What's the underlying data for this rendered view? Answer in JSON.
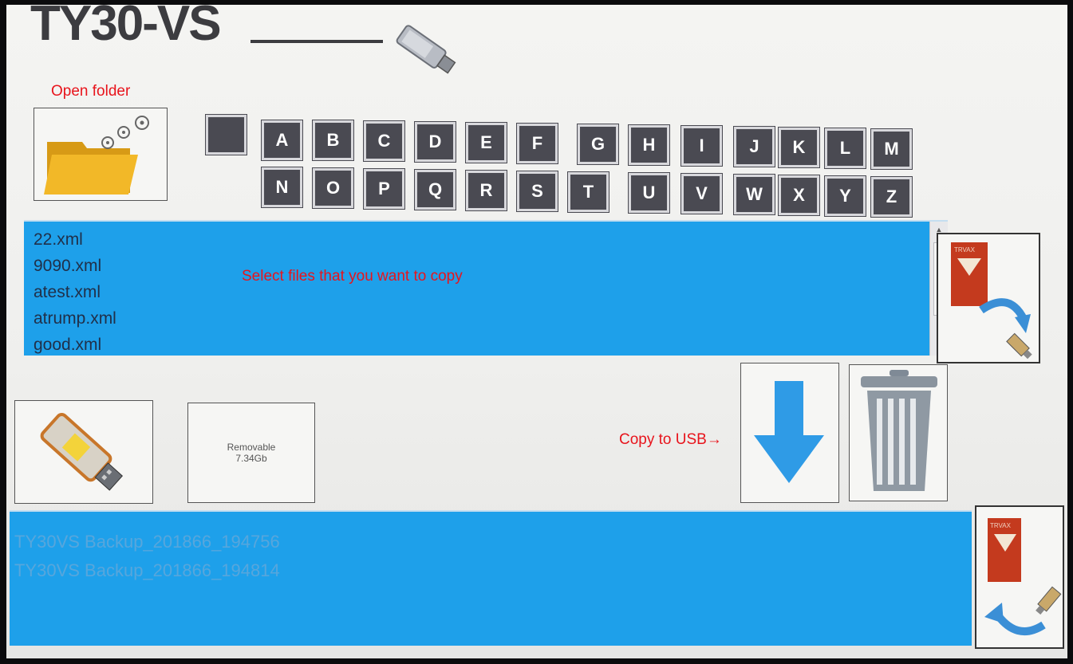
{
  "header": {
    "title": "TY30-VS"
  },
  "annotations": {
    "open_folder": "Open folder",
    "select_files": "Select files that you want to copy",
    "copy_to_usb": "Copy to USB→"
  },
  "keyboard": {
    "row1": [
      "",
      "A",
      "B",
      "C",
      "D",
      "E",
      "F",
      "G",
      "H",
      "I",
      "J",
      "K",
      "L",
      "M"
    ],
    "row2": [
      "N",
      "O",
      "P",
      "Q",
      "R",
      "S",
      "T",
      "U",
      "V",
      "W",
      "X",
      "Y",
      "Z"
    ]
  },
  "source_files": [
    "22.xml",
    "9090.xml",
    "atest.xml",
    "atrump.xml",
    "good.xml"
  ],
  "drive": {
    "label": "Removable",
    "size": "7.34Gb"
  },
  "usb_files": [
    "TY30VS Backup_201866_194756",
    "TY30VS Backup_201866_194814"
  ],
  "icons": {
    "usb_header": "usb-stick-icon",
    "open_folder": "folder-icon",
    "device_to_usb": "device-to-usb-icon",
    "usb_drive": "usb-drive-icon",
    "copy": "down-arrow-icon",
    "delete": "trash-icon",
    "usb_to_device": "usb-to-device-icon"
  },
  "colors": {
    "list_bg": "#1ea0ea",
    "key_bg": "#4a4a52",
    "annotation": "#e8141c",
    "arrow": "#2f9be6"
  }
}
